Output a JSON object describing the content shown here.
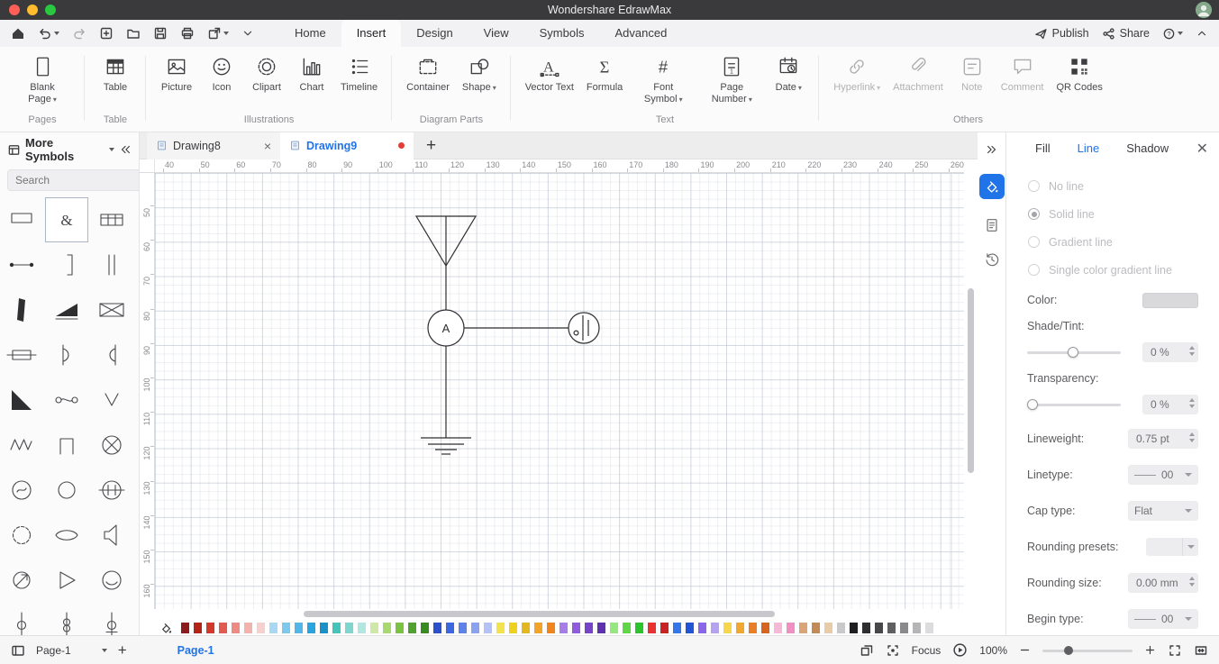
{
  "titlebar": {
    "title": "Wondershare EdrawMax"
  },
  "toolbar": {
    "tabs": [
      {
        "label": "Home",
        "active": false
      },
      {
        "label": "Insert",
        "active": true
      },
      {
        "label": "Design",
        "active": false
      },
      {
        "label": "View",
        "active": false
      },
      {
        "label": "Symbols",
        "active": false
      },
      {
        "label": "Advanced",
        "active": false
      }
    ],
    "publish_label": "Publish",
    "share_label": "Share"
  },
  "ribbon": {
    "groups": [
      {
        "label": "Pages",
        "items": [
          {
            "label": "Blank Page",
            "icon": "blank-page",
            "dropdown": true,
            "disabled": false
          }
        ]
      },
      {
        "label": "Table",
        "items": [
          {
            "label": "Table",
            "icon": "table",
            "dropdown": false,
            "disabled": false
          }
        ]
      },
      {
        "label": "Illustrations",
        "items": [
          {
            "label": "Picture",
            "icon": "picture",
            "dropdown": false,
            "disabled": false
          },
          {
            "label": "Icon",
            "icon": "smiley",
            "dropdown": false,
            "disabled": false
          },
          {
            "label": "Clipart",
            "icon": "clipart",
            "dropdown": false,
            "disabled": false
          },
          {
            "label": "Chart",
            "icon": "chart",
            "dropdown": false,
            "disabled": false
          },
          {
            "label": "Timeline",
            "icon": "timeline",
            "dropdown": false,
            "disabled": false
          }
        ]
      },
      {
        "label": "Diagram Parts",
        "items": [
          {
            "label": "Container",
            "icon": "container",
            "dropdown": false,
            "disabled": false
          },
          {
            "label": "Shape",
            "icon": "shape",
            "dropdown": true,
            "disabled": false
          }
        ]
      },
      {
        "label": "Text",
        "items": [
          {
            "label": "Vector Text",
            "icon": "vector-text",
            "dropdown": false,
            "disabled": false
          },
          {
            "label": "Formula",
            "icon": "formula",
            "dropdown": false,
            "disabled": false
          },
          {
            "label": "Font Symbol",
            "icon": "font-symbol",
            "dropdown": true,
            "disabled": false
          },
          {
            "label": "Page Number",
            "icon": "page-number",
            "dropdown": true,
            "disabled": false
          },
          {
            "label": "Date",
            "icon": "date",
            "dropdown": true,
            "disabled": false
          }
        ]
      },
      {
        "label": "Others",
        "items": [
          {
            "label": "Hyperlink",
            "icon": "hyperlink",
            "dropdown": true,
            "disabled": true
          },
          {
            "label": "Attachment",
            "icon": "attachment",
            "dropdown": false,
            "disabled": true
          },
          {
            "label": "Note",
            "icon": "note",
            "dropdown": false,
            "disabled": true
          },
          {
            "label": "Comment",
            "icon": "comment",
            "dropdown": false,
            "disabled": true
          },
          {
            "label": "QR Codes",
            "icon": "qr-codes",
            "dropdown": false,
            "disabled": false
          }
        ]
      }
    ]
  },
  "sidebar": {
    "title": "More Symbols",
    "search_placeholder": "Search",
    "selected_symbol_index": 1,
    "symbols": [
      "terminal-rect",
      "selected-symbol",
      "table-rect",
      "dot-line",
      "bracket",
      "parallel-lines",
      "solid-bar",
      "solid-wedge",
      "crossed-box",
      "fuse",
      "shell-left",
      "shell-right",
      "corner-triangle",
      "coupler",
      "v-shape",
      "sawtooth",
      "staple",
      "circle-x",
      "motor",
      "circle",
      "lamp-holder",
      "wavy-circle",
      "lens",
      "speaker",
      "circle-arrow",
      "triangle-right",
      "circle-arc",
      "pole-a",
      "pole-b",
      "pole-c"
    ]
  },
  "doc_tabs": [
    {
      "label": "Drawing8",
      "active": false,
      "modified": false,
      "closable": true
    },
    {
      "label": "Drawing9",
      "active": true,
      "modified": true,
      "closable": false
    }
  ],
  "rulers": {
    "horizontal": [
      40,
      50,
      60,
      70,
      80,
      90,
      100,
      110,
      120,
      130,
      140,
      150,
      160,
      170,
      180,
      190,
      200,
      210,
      220,
      230,
      240,
      250,
      260
    ],
    "vertical": [
      50,
      60,
      70,
      80,
      90,
      100,
      110,
      120,
      130,
      140,
      150,
      160
    ]
  },
  "canvas": {
    "ammeter_label": "A"
  },
  "palette": [
    "#8e1b1b",
    "#b22318",
    "#d03a2b",
    "#e25b50",
    "#ec8a83",
    "#f2b3ae",
    "#f7d0cd",
    "#a9d9f2",
    "#7ec8ec",
    "#53b6e6",
    "#2ba3de",
    "#1b8fc7",
    "#45c4bb",
    "#7fd6cf",
    "#b2e6e1",
    "#cfe8a8",
    "#a8d870",
    "#7cc242",
    "#52a02f",
    "#3a8a22",
    "#2a51c9",
    "#3d68dd",
    "#5f82e8",
    "#8aa2f0",
    "#b4c2f5",
    "#f2e34d",
    "#eed021",
    "#e2b71f",
    "#f2a32a",
    "#ee851f",
    "#a77de8",
    "#8f5cdd",
    "#7643c9",
    "#5f32ad",
    "#94e87f",
    "#5ed648",
    "#2cc42c",
    "#e83333",
    "#c92222",
    "#3377e8",
    "#2255d6",
    "#8a66e8",
    "#b5a2f0",
    "#f5d64d",
    "#f0a830",
    "#e87f27",
    "#d6661f",
    "#f5b8d6",
    "#ef8fc2",
    "#d9a577",
    "#c28a55",
    "#e8cba9",
    "#c9c9cc",
    "#1f1f21",
    "#2e2e30",
    "#47474a",
    "#5f5f62",
    "#8a8a8d",
    "#b5b5b8",
    "#dcdcde"
  ],
  "right_panel": {
    "tabs": [
      {
        "label": "Fill",
        "active": false
      },
      {
        "label": "Line",
        "active": true
      },
      {
        "label": "Shadow",
        "active": false
      }
    ],
    "line_options": [
      {
        "label": "No line",
        "selected": false
      },
      {
        "label": "Solid line",
        "selected": true
      },
      {
        "label": "Gradient line",
        "selected": false
      },
      {
        "label": "Single color gradient line",
        "selected": false
      }
    ],
    "fields": [
      {
        "label": "Color:",
        "type": "swatch",
        "value": ""
      },
      {
        "label": "Shade/Tint:",
        "type": "slider",
        "value": "0 %",
        "pos": 49
      },
      {
        "label": "Transparency:",
        "type": "slider",
        "value": "0 %",
        "pos": 6
      },
      {
        "label": "Lineweight:",
        "type": "spin",
        "value": "0.75 pt"
      },
      {
        "label": "Linetype:",
        "type": "linedrop",
        "value": "00"
      },
      {
        "label": "Cap type:",
        "type": "drop",
        "value": "Flat"
      },
      {
        "label": "Rounding presets:",
        "type": "smalldrop",
        "value": ""
      },
      {
        "label": "Rounding size:",
        "type": "spin",
        "value": "0.00 mm"
      },
      {
        "label": "Begin type:",
        "type": "linedrop",
        "value": "00"
      }
    ]
  },
  "statusbar": {
    "page_selector": "Page-1",
    "page_tab": "Page-1",
    "focus_label": "Focus",
    "zoom": "100%"
  }
}
